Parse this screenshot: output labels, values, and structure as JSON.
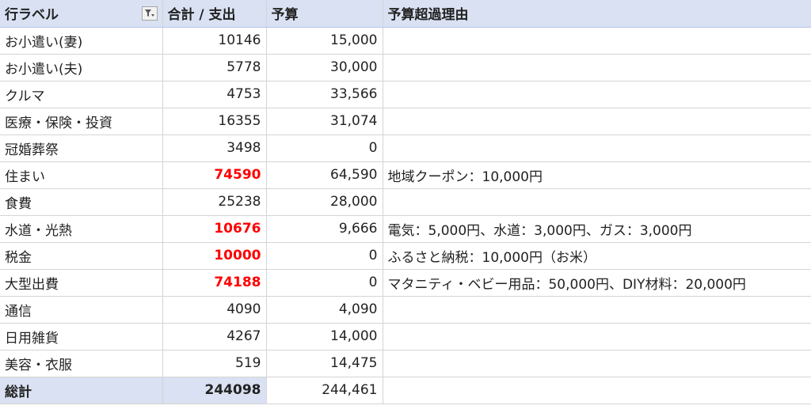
{
  "header": {
    "row_label": "行ラベル",
    "sum_label": "合計 / 支出",
    "budget_label": "予算",
    "reason_label": "予算超過理由",
    "filter_icon": "filter-dropdown-icon"
  },
  "rows": [
    {
      "label": "お小遣い(妻)",
      "sum": "10146",
      "budget": "15,000",
      "reason": "",
      "over": false
    },
    {
      "label": "お小遣い(夫)",
      "sum": "5778",
      "budget": "30,000",
      "reason": "",
      "over": false
    },
    {
      "label": "クルマ",
      "sum": "4753",
      "budget": "33,566",
      "reason": "",
      "over": false
    },
    {
      "label": "医療・保険・投資",
      "sum": "16355",
      "budget": "31,074",
      "reason": "",
      "over": false
    },
    {
      "label": "冠婚葬祭",
      "sum": "3498",
      "budget": "0",
      "reason": "",
      "over": false
    },
    {
      "label": "住まい",
      "sum": "74590",
      "budget": "64,590",
      "reason": "地域クーポン：10,000円",
      "over": true
    },
    {
      "label": "食費",
      "sum": "25238",
      "budget": "28,000",
      "reason": "",
      "over": false
    },
    {
      "label": "水道・光熱",
      "sum": "10676",
      "budget": "9,666",
      "reason": "電気：5,000円、水道：3,000円、ガス：3,000円",
      "over": true
    },
    {
      "label": "税金",
      "sum": "10000",
      "budget": "0",
      "reason": "ふるさと納税：10,000円（お米）",
      "over": true
    },
    {
      "label": "大型出費",
      "sum": "74188",
      "budget": "0",
      "reason": "マタニティ・ベビー用品：50,000円、DIY材料：20,000円",
      "over": true
    },
    {
      "label": "通信",
      "sum": "4090",
      "budget": "4,090",
      "reason": "",
      "over": false
    },
    {
      "label": "日用雑貨",
      "sum": "4267",
      "budget": "14,000",
      "reason": "",
      "over": false
    },
    {
      "label": "美容・衣服",
      "sum": "519",
      "budget": "14,475",
      "reason": "",
      "over": false
    }
  ],
  "total": {
    "label": "総計",
    "sum": "244098",
    "budget": "244,461",
    "reason": ""
  },
  "colors": {
    "header_bg": "#d9e1f2",
    "over_budget": "#ff0000",
    "gridline": "#d4d4d4"
  }
}
